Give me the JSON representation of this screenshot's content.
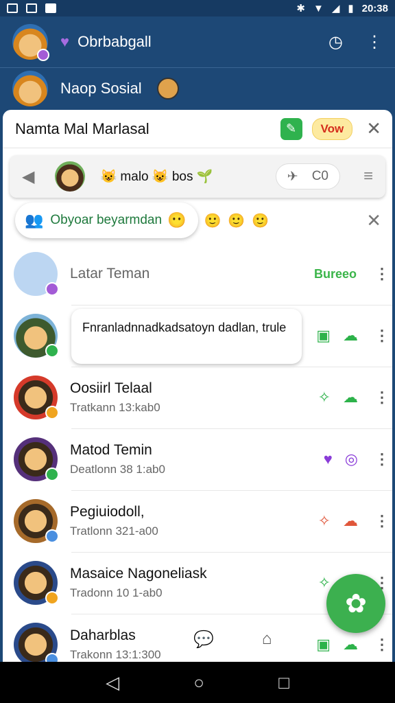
{
  "status": {
    "time": "20:38"
  },
  "header": {
    "account_name": "Obrbabgall",
    "second_account": "Naop Sosial"
  },
  "card": {
    "title": "Namta Mal Marlasal",
    "view_label": "Vow",
    "toolbar_text": "malo",
    "toolbar_text2": "bos",
    "toolbar_pill_text": "C0",
    "chip_text": "Obyoar beyarmdan"
  },
  "contacts": [
    {
      "name": "Latar Teman",
      "tag": "Bureeo"
    },
    {
      "bubble": "Fnranladnnadkadsatoyn dadlan, trule"
    },
    {
      "name": "Oosiirl Telaal",
      "sub": "Tratkann 13:kab0"
    },
    {
      "name": "Matod Temin",
      "sub": "Deatlonn 38 1:ab0"
    },
    {
      "name": "Pegiuiodoll,",
      "sub": "Tratlonn 321-a00"
    },
    {
      "name": "Masaice Nagoneliask",
      "sub": "Tradonn 10 1-ab0"
    },
    {
      "name": "Daharblas",
      "sub": "Trakonn 13:1:300"
    }
  ],
  "colors": {
    "accent": "#3cb04f",
    "header": "#1d4876",
    "badge": "#a35bd6"
  }
}
